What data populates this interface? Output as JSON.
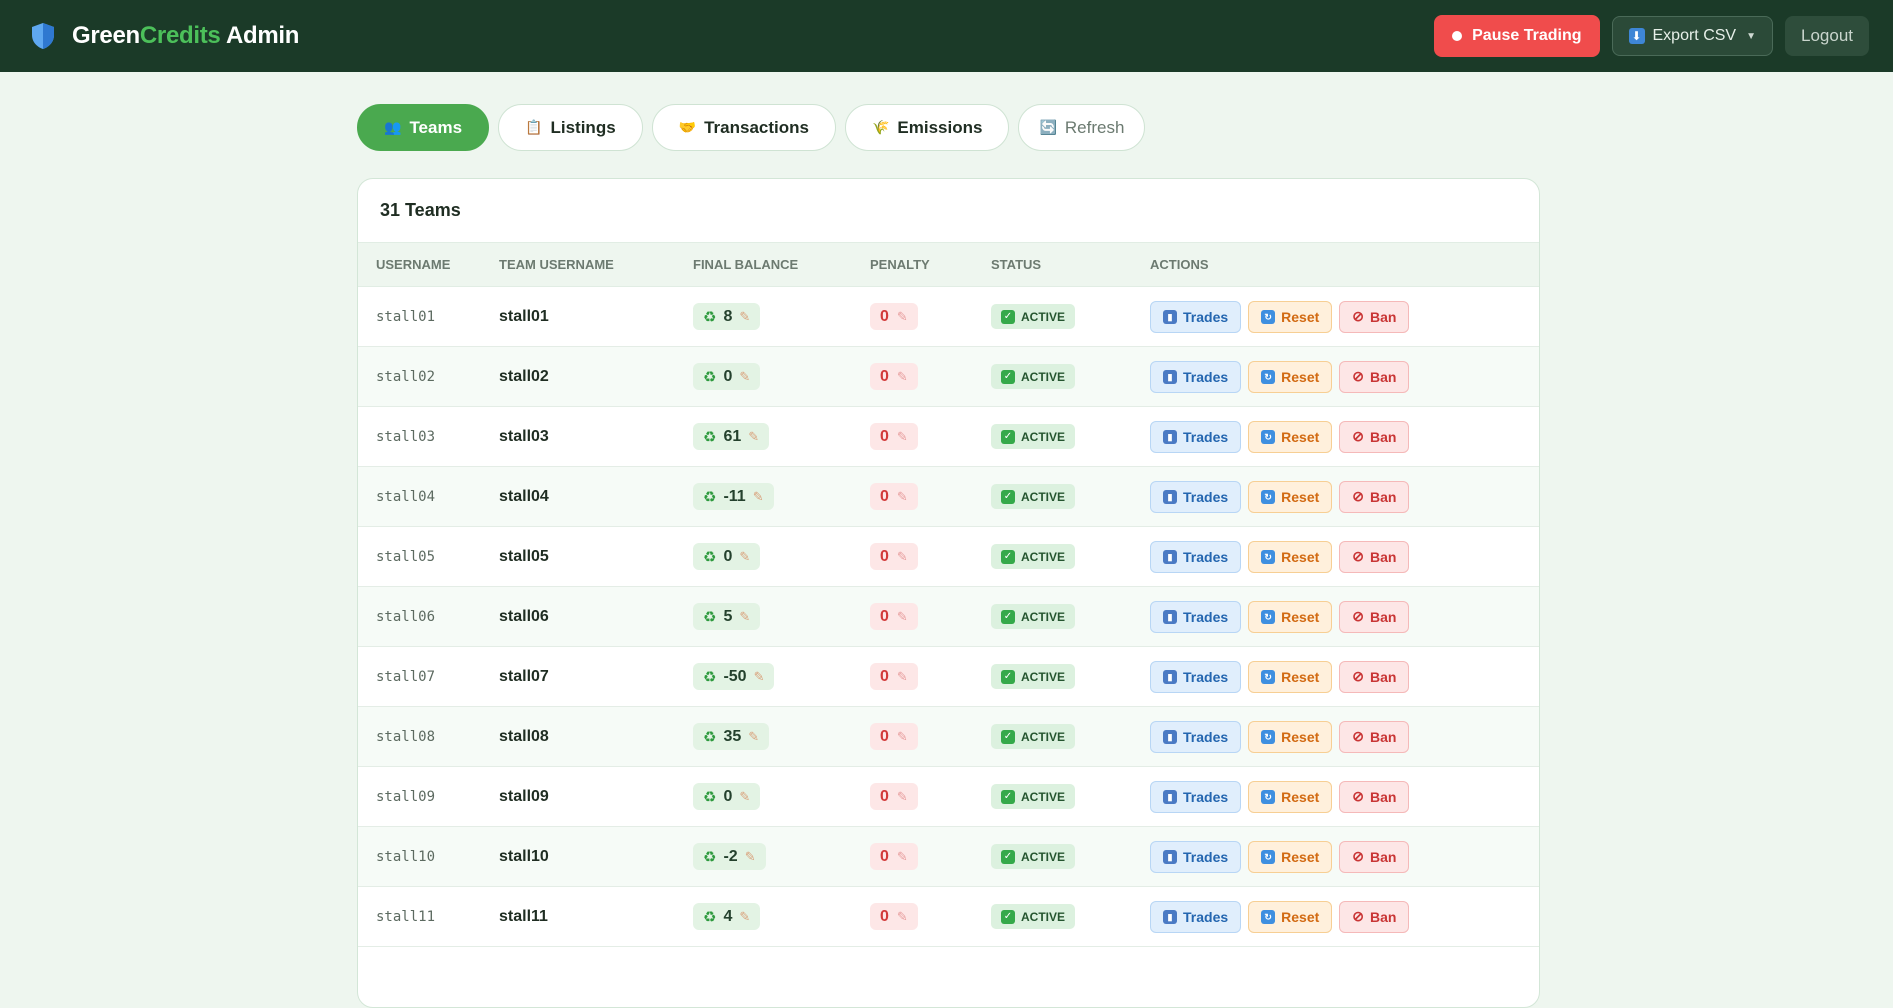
{
  "header": {
    "brand_part1": "Green",
    "brand_part2": "Credits",
    "brand_part3": " Admin",
    "pause_label": "Pause Trading",
    "export_label": "Export CSV",
    "logout_label": "Logout"
  },
  "tabs": [
    {
      "icon": "👥",
      "label": "Teams",
      "active": true
    },
    {
      "icon": "📋",
      "label": "Listings"
    },
    {
      "icon": "🤝",
      "label": "Transactions"
    },
    {
      "icon": "🌾",
      "label": "Emissions"
    },
    {
      "icon": "🔄",
      "label": "Refresh"
    }
  ],
  "table": {
    "title": "31 Teams",
    "columns": [
      "USERNAME",
      "TEAM USERNAME",
      "FINAL BALANCE",
      "PENALTY",
      "STATUS",
      "ACTIONS"
    ],
    "action_labels": {
      "trades": "Trades",
      "reset": "Reset",
      "ban": "Ban"
    },
    "rows": [
      {
        "username": "stall01",
        "team": "stall01",
        "balance": "8",
        "penalty": "0",
        "status": "ACTIVE"
      },
      {
        "username": "stall02",
        "team": "stall02",
        "balance": "0",
        "penalty": "0",
        "status": "ACTIVE"
      },
      {
        "username": "stall03",
        "team": "stall03",
        "balance": "61",
        "penalty": "0",
        "status": "ACTIVE"
      },
      {
        "username": "stall04",
        "team": "stall04",
        "balance": "-11",
        "penalty": "0",
        "status": "ACTIVE"
      },
      {
        "username": "stall05",
        "team": "stall05",
        "balance": "0",
        "penalty": "0",
        "status": "ACTIVE"
      },
      {
        "username": "stall06",
        "team": "stall06",
        "balance": "5",
        "penalty": "0",
        "status": "ACTIVE"
      },
      {
        "username": "stall07",
        "team": "stall07",
        "balance": "-50",
        "penalty": "0",
        "status": "ACTIVE"
      },
      {
        "username": "stall08",
        "team": "stall08",
        "balance": "35",
        "penalty": "0",
        "status": "ACTIVE"
      },
      {
        "username": "stall09",
        "team": "stall09",
        "balance": "0",
        "penalty": "0",
        "status": "ACTIVE"
      },
      {
        "username": "stall10",
        "team": "stall10",
        "balance": "-2",
        "penalty": "0",
        "status": "ACTIVE"
      },
      {
        "username": "stall11",
        "team": "stall11",
        "balance": "4",
        "penalty": "0",
        "status": "ACTIVE"
      }
    ]
  },
  "colors": {
    "topbar": "#1b3a28",
    "accent_green": "#4aa94f",
    "pause_red": "#f04c4c",
    "page_bg": "#eef6ef"
  },
  "icons": {
    "logo": "shield-icon",
    "balance": "recycle-icon",
    "edit": "pencil-icon",
    "status": "check-icon",
    "trades": "chart-icon",
    "reset": "reload-icon",
    "ban": "ban-icon"
  }
}
